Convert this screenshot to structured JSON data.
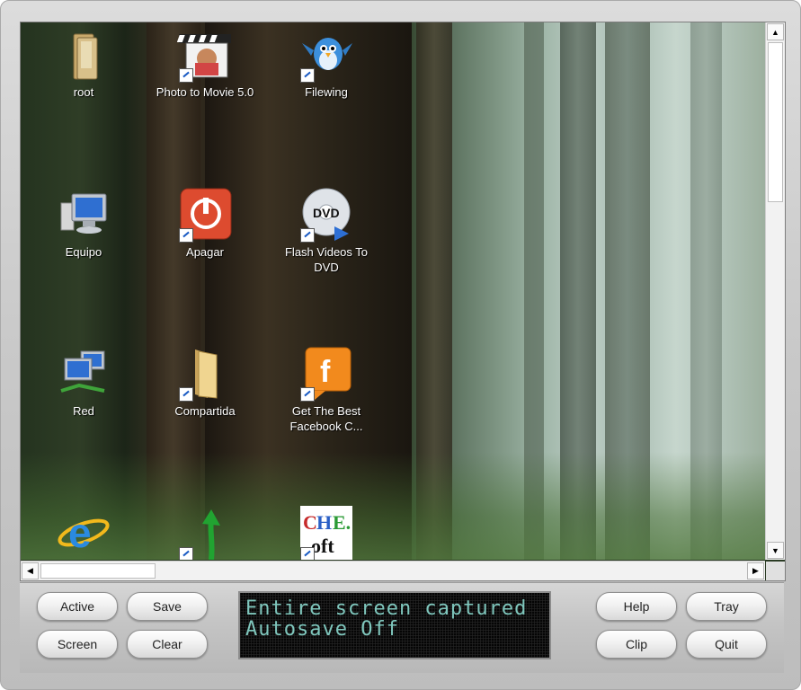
{
  "desktop": {
    "icons": [
      {
        "label": "root",
        "icon": "folder-icon"
      },
      {
        "label": "Photo to Movie 5.0",
        "icon": "photo-to-movie-icon"
      },
      {
        "label": "Filewing",
        "icon": "bird-icon"
      },
      {
        "label": "Equipo",
        "icon": "computer-icon"
      },
      {
        "label": "Apagar",
        "icon": "power-icon"
      },
      {
        "label": "Flash Videos To DVD",
        "icon": "dvd-icon"
      },
      {
        "label": "Red",
        "icon": "network-icon"
      },
      {
        "label": "Compartida",
        "icon": "folder-icon"
      },
      {
        "label": "Get The Best Facebook C...",
        "icon": "facebook-icon"
      },
      {
        "label": "",
        "icon": "internet-explorer-icon"
      },
      {
        "label": "",
        "icon": "green-arrow-icon"
      },
      {
        "label": "",
        "icon": "chesoft-icon"
      }
    ]
  },
  "buttons": {
    "active": "Active",
    "save": "Save",
    "screen": "Screen",
    "clear": "Clear",
    "help": "Help",
    "tray": "Tray",
    "clip": "Clip",
    "quit": "Quit"
  },
  "status": {
    "line1": "Entire screen captured",
    "line2": "Autosave Off"
  },
  "colors": {
    "lcd_text": "#7fc7bd",
    "lcd_background": "#050505"
  }
}
